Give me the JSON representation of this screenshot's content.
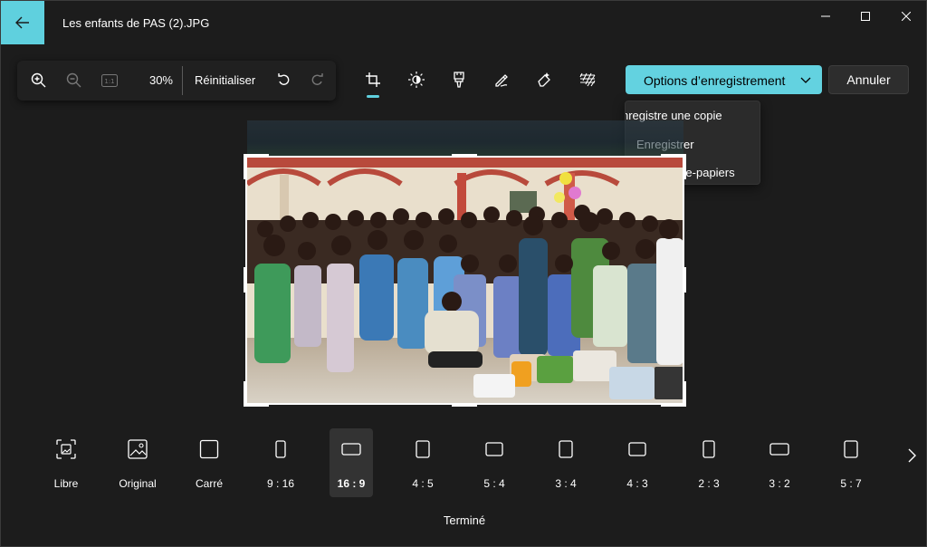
{
  "window": {
    "title": "Les enfants de PAS (2).JPG",
    "accent": "#5fd0de"
  },
  "zoom_toolbar": {
    "zoom_in": "zoom-in-icon",
    "zoom_out": "zoom-out-icon",
    "actual_size": "1:1",
    "zoom_value": "30%",
    "reset_label": "Réinitialiser",
    "undo": "undo-icon",
    "redo": "redo-icon"
  },
  "tools": [
    "crop-icon",
    "adjust-icon",
    "filter-icon",
    "markup-icon",
    "erase-icon",
    "background-icon"
  ],
  "actions": {
    "save_options_label": "Options d’enregistrement",
    "cancel_label": "Annuler",
    "save_menu": [
      {
        "label": "nregistre une copie"
      },
      {
        "label": "Enregistrer"
      },
      {
        "label": "lans le Presse-papiers"
      }
    ]
  },
  "aspect_ratios": [
    {
      "label": "Libre",
      "icon": "free-crop-icon",
      "selected": false
    },
    {
      "label": "Original",
      "icon": "image-icon",
      "selected": false
    },
    {
      "label": "Carré",
      "icon": "square-icon",
      "selected": false
    },
    {
      "label": "9 : 16",
      "icon": "portrait-icon",
      "selected": false
    },
    {
      "label": "16 : 9",
      "icon": "landscape-icon",
      "selected": true
    },
    {
      "label": "4 : 5",
      "icon": "portrait-icon",
      "selected": false
    },
    {
      "label": "5 : 4",
      "icon": "landscape-icon",
      "selected": false
    },
    {
      "label": "3 : 4",
      "icon": "portrait-icon",
      "selected": false
    },
    {
      "label": "4 : 3",
      "icon": "landscape-icon",
      "selected": false
    },
    {
      "label": "2 : 3",
      "icon": "portrait-icon",
      "selected": false
    },
    {
      "label": "3 : 2",
      "icon": "landscape-icon",
      "selected": false
    },
    {
      "label": "5 : 7",
      "icon": "portrait-icon",
      "selected": false
    }
  ],
  "done_label": "Terminé"
}
